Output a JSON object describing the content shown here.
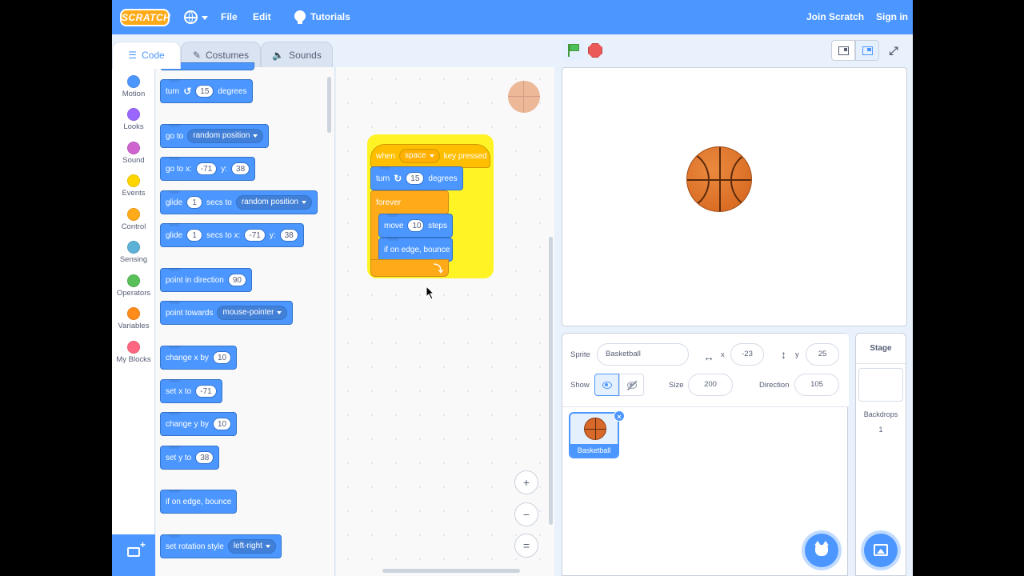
{
  "menubar": {
    "logo": "SCRATCH",
    "file": "File",
    "edit": "Edit",
    "tutorials": "Tutorials",
    "join": "Join Scratch",
    "signin": "Sign in"
  },
  "tabs": {
    "code": "Code",
    "costumes": "Costumes",
    "sounds": "Sounds"
  },
  "categories": [
    {
      "label": "Motion",
      "color": "#4c97ff"
    },
    {
      "label": "Looks",
      "color": "#9966ff"
    },
    {
      "label": "Sound",
      "color": "#cf63cf"
    },
    {
      "label": "Events",
      "color": "#ffd500"
    },
    {
      "label": "Control",
      "color": "#ffab19"
    },
    {
      "label": "Sensing",
      "color": "#5cb1d6"
    },
    {
      "label": "Operators",
      "color": "#59c059"
    },
    {
      "label": "Variables",
      "color": "#ff8c1a"
    },
    {
      "label": "My Blocks",
      "color": "#ff6680"
    }
  ],
  "palette": {
    "turn": {
      "prefix": "turn",
      "value": "15",
      "suffix": "degrees"
    },
    "goto": {
      "prefix": "go to",
      "option": "random position"
    },
    "gotoxy": {
      "prefix": "go to x:",
      "x": "-71",
      "ylabel": "y:",
      "y": "38"
    },
    "glide_to": {
      "prefix": "glide",
      "secs": "1",
      "mid": "secs to",
      "option": "random position"
    },
    "glide_xy": {
      "prefix": "glide",
      "secs": "1",
      "mid": "secs to x:",
      "x": "-71",
      "ylabel": "y:",
      "y": "38"
    },
    "point_dir": {
      "prefix": "point in direction",
      "value": "90"
    },
    "point_towards": {
      "prefix": "point towards",
      "option": "mouse-pointer"
    },
    "change_x": {
      "prefix": "change x by",
      "value": "10"
    },
    "set_x": {
      "prefix": "set x to",
      "value": "-71"
    },
    "change_y": {
      "prefix": "change y by",
      "value": "10"
    },
    "set_y": {
      "prefix": "set y to",
      "value": "38"
    },
    "bounce": {
      "label": "if on edge, bounce"
    },
    "rotation": {
      "prefix": "set rotation style",
      "option": "left-right"
    }
  },
  "script": {
    "hat": {
      "prefix": "when",
      "key": "space",
      "suffix": "key pressed"
    },
    "turn": {
      "prefix": "turn",
      "value": "15",
      "suffix": "degrees"
    },
    "forever": "forever",
    "move": {
      "prefix": "move",
      "value": "10",
      "suffix": "steps"
    },
    "bounce": "if on edge, bounce"
  },
  "zoom": {
    "in": "+",
    "out": "−",
    "reset": "="
  },
  "sprite_info": {
    "sprite_label": "Sprite",
    "sprite_name": "Basketball",
    "x_label": "x",
    "x": "-23",
    "y_label": "y",
    "y": "25",
    "show_label": "Show",
    "size_label": "Size",
    "size": "200",
    "direction_label": "Direction",
    "direction": "105"
  },
  "sprites": [
    {
      "name": "Basketball"
    }
  ],
  "stage_pane": {
    "title": "Stage",
    "backdrops_label": "Backdrops",
    "backdrops_count": "1"
  },
  "colors": {
    "motion": "#4c97ff",
    "events": "#ffbf00",
    "control": "#ffab19",
    "menubar": "#4c97ff"
  }
}
